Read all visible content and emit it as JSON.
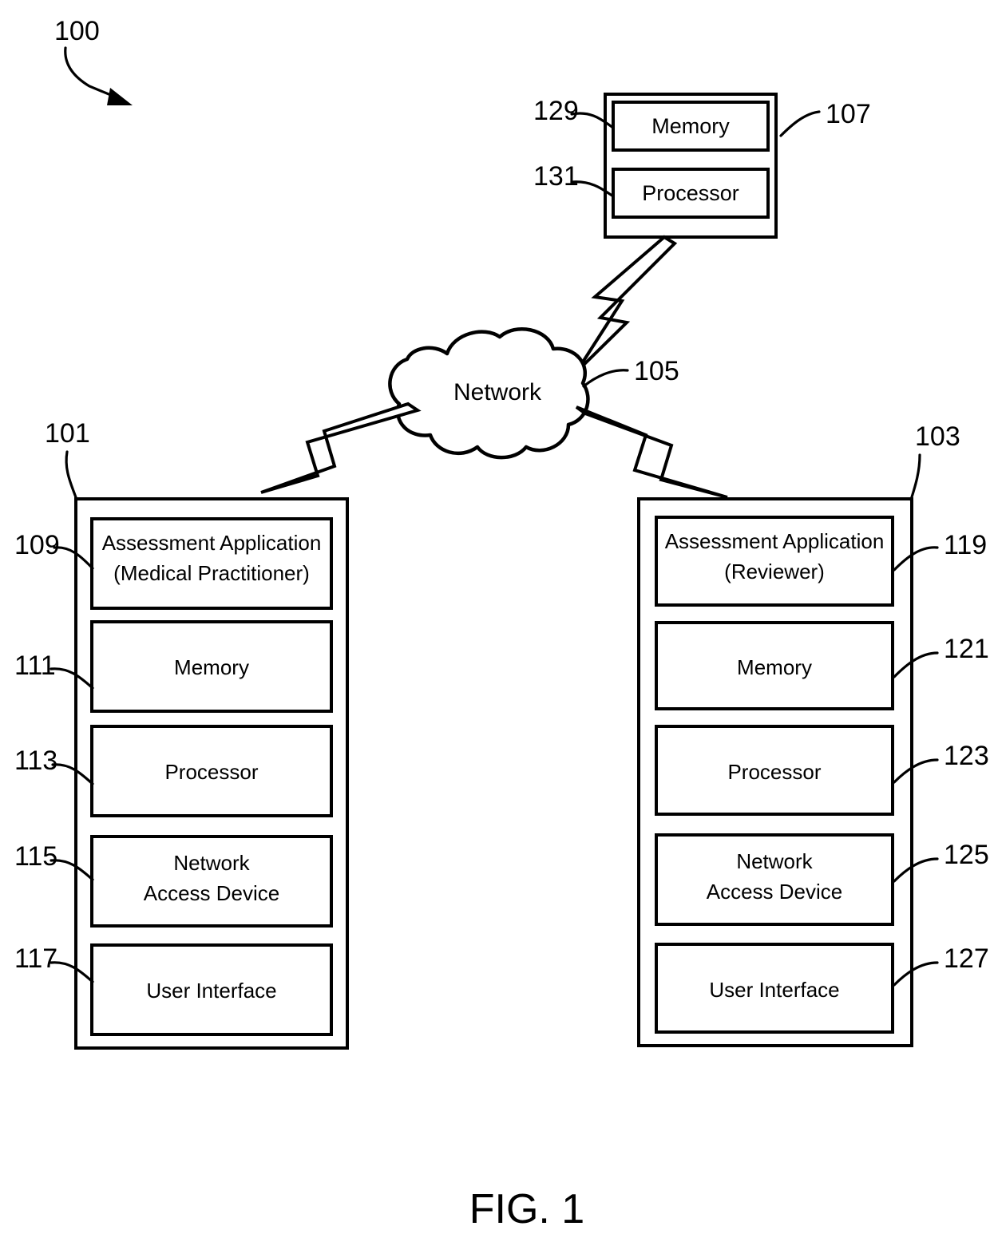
{
  "figure": {
    "caption": "FIG. 1",
    "system_ref": "100"
  },
  "server": {
    "ref": "107",
    "memory": {
      "label": "Memory",
      "ref": "129"
    },
    "processor": {
      "label": "Processor",
      "ref": "131"
    }
  },
  "network": {
    "label": "Network",
    "ref": "105"
  },
  "left_device": {
    "ref": "101",
    "components": [
      {
        "label": "Assessment Application",
        "label2": "(Medical Practitioner)",
        "ref": "109"
      },
      {
        "label": "Memory",
        "label2": "",
        "ref": "111"
      },
      {
        "label": "Processor",
        "label2": "",
        "ref": "113"
      },
      {
        "label": "Network",
        "label2": "Access Device",
        "ref": "115"
      },
      {
        "label": "User Interface",
        "label2": "",
        "ref": "117"
      }
    ]
  },
  "right_device": {
    "ref": "103",
    "components": [
      {
        "label": "Assessment Application",
        "label2": "(Reviewer)",
        "ref": "119"
      },
      {
        "label": "Memory",
        "label2": "",
        "ref": "121"
      },
      {
        "label": "Processor",
        "label2": "",
        "ref": "123"
      },
      {
        "label": "Network",
        "label2": "Access Device",
        "ref": "125"
      },
      {
        "label": "User Interface",
        "label2": "",
        "ref": "127"
      }
    ]
  },
  "colors": {
    "ink": "#000000",
    "paper": "#ffffff"
  }
}
